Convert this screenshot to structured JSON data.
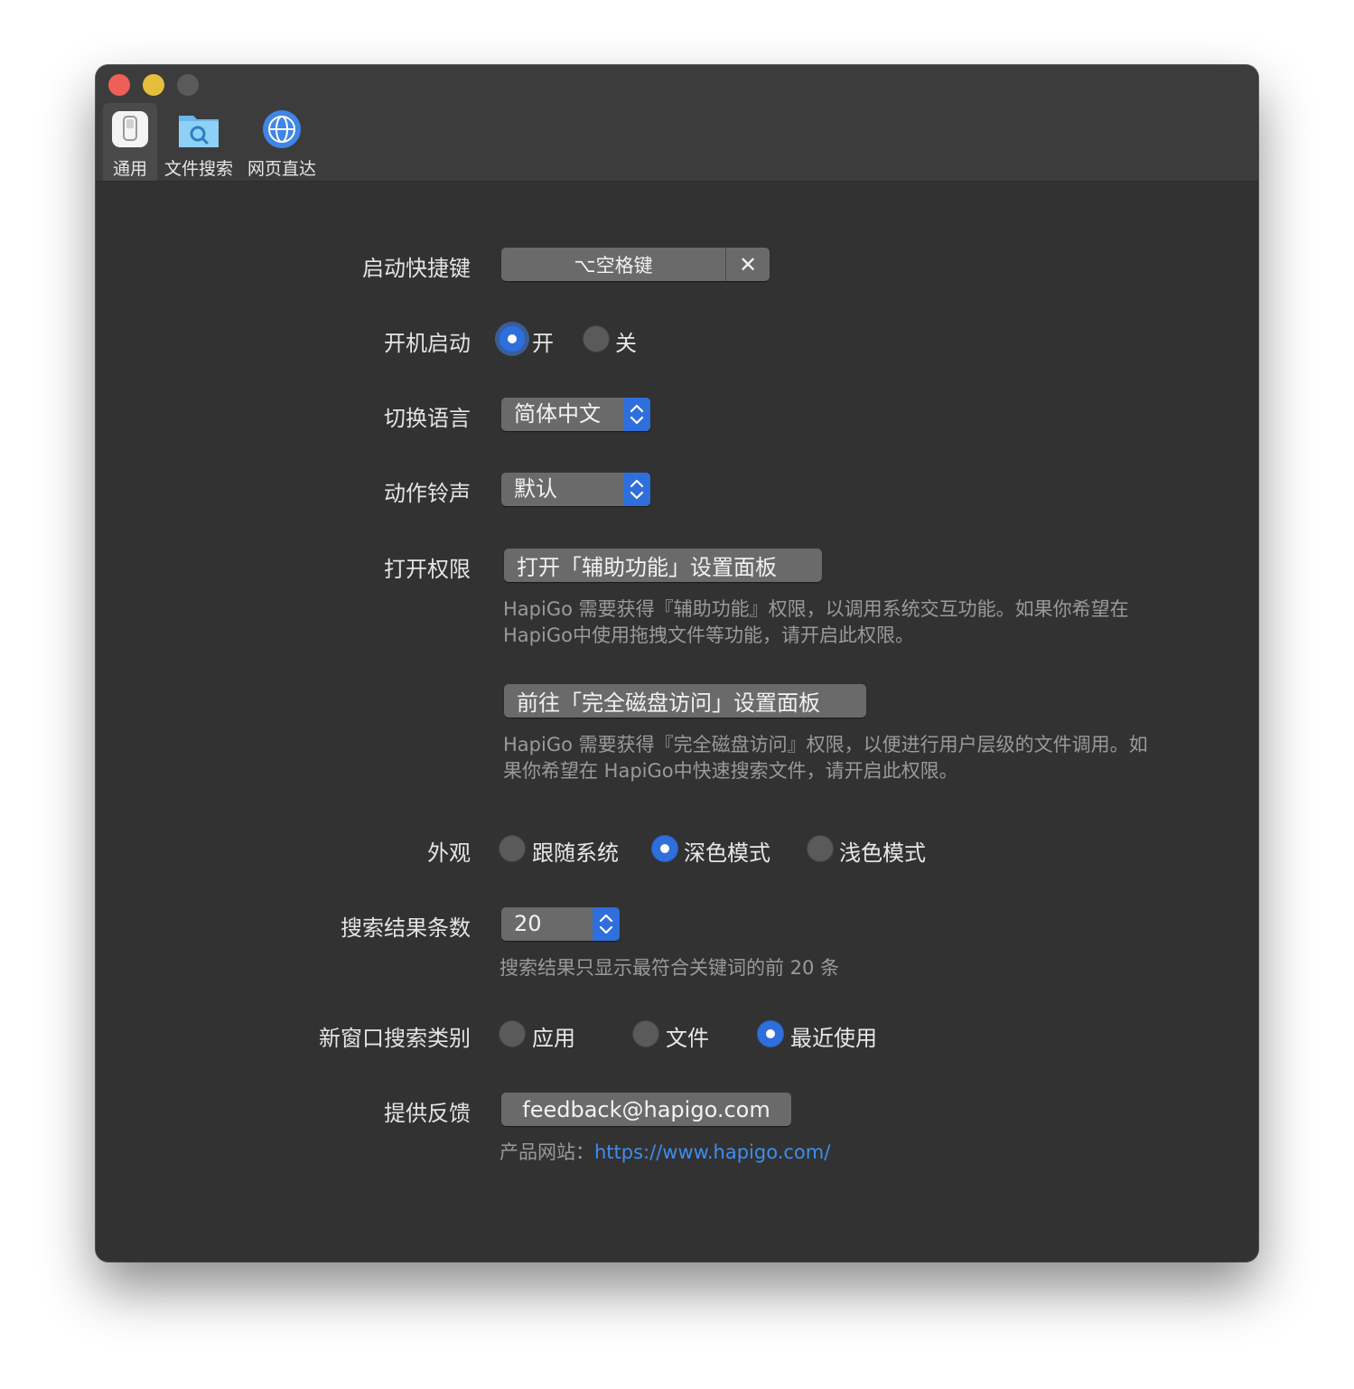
{
  "tabs": [
    {
      "label": "通用",
      "icon": "general-switch-icon",
      "active": true
    },
    {
      "label": "文件搜索",
      "icon": "folder-search-icon",
      "active": false
    },
    {
      "label": "网页直达",
      "icon": "globe-icon",
      "active": false
    }
  ],
  "hotkey": {
    "label": "启动快捷键",
    "value": "⌥空格键",
    "clear": "✕"
  },
  "launch": {
    "label": "开机启动",
    "on": "开",
    "off": "关",
    "selected": "on"
  },
  "language": {
    "label": "切换语言",
    "value": "简体中文"
  },
  "sound": {
    "label": "动作铃声",
    "value": "默认"
  },
  "permission": {
    "label": "打开权限",
    "accessibility_button": "打开「辅助功能」设置面板",
    "accessibility_desc_1": "HapiGo 需要获得『辅助功能』权限，以调用系统交互功能。如果你希望在",
    "accessibility_desc_2": "HapiGo中使用拖拽文件等功能，请开启此权限。",
    "disk_button": "前往「完全磁盘访问」设置面板",
    "disk_desc_1": "HapiGo 需要获得『完全磁盘访问』权限，以便进行用户层级的文件调用。如",
    "disk_desc_2": "果你希望在 HapiGo中快速搜索文件，请开启此权限。"
  },
  "appearance": {
    "label": "外观",
    "options": [
      "跟随系统",
      "深色模式",
      "浅色模式"
    ],
    "selected": "深色模式"
  },
  "result_count": {
    "label": "搜索结果条数",
    "value": "20",
    "desc": "搜索结果只显示最符合关键词的前 20 条"
  },
  "new_window": {
    "label": "新窗口搜索类别",
    "options": [
      "应用",
      "文件",
      "最近使用"
    ],
    "selected": "最近使用"
  },
  "feedback": {
    "label": "提供反馈",
    "email": "feedback@hapigo.com",
    "site_label": "产品网站：",
    "site_url": "https://www.hapigo.com/"
  },
  "colors": {
    "accent": "#2f6fdc",
    "window_bg": "#323232",
    "link": "#3d8ef0"
  }
}
